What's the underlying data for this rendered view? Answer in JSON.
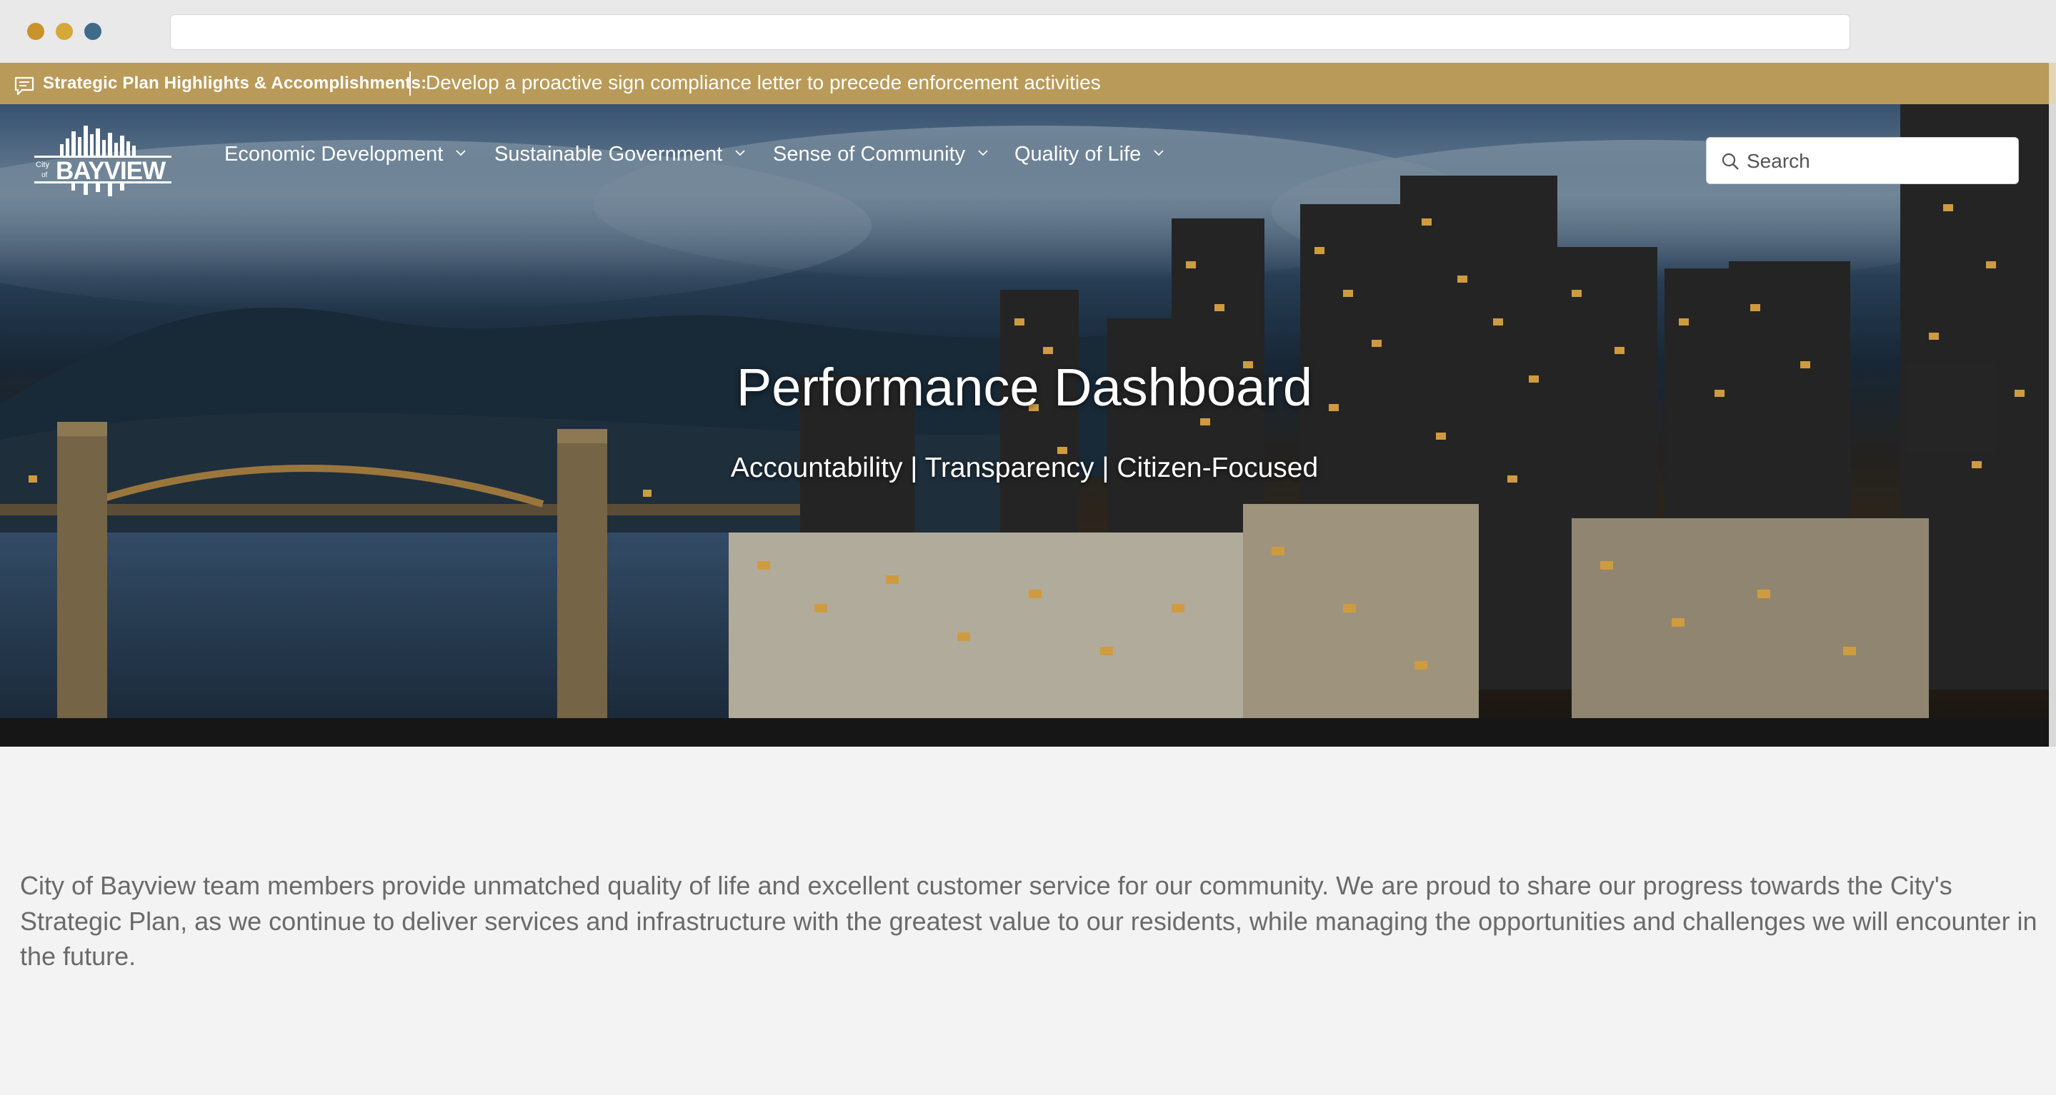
{
  "browser": {
    "dot_colors": [
      "#c9922a",
      "#d4a93a",
      "#3f6b8a"
    ]
  },
  "announcement": {
    "label": "Strategic Plan Highlights & Accomplishments:",
    "message": "Develop a proactive sign compliance letter to precede enforcement activities",
    "icon": "message-icon",
    "color": "#b99a58"
  },
  "header": {
    "logo": {
      "prefix_top": "City",
      "prefix_bottom": "of",
      "name": "BAYVIEW"
    },
    "nav": [
      {
        "label": "Economic Development"
      },
      {
        "label": "Sustainable Government"
      },
      {
        "label": "Sense of Community"
      },
      {
        "label": "Quality of Life"
      }
    ],
    "search": {
      "placeholder": "Search",
      "icon": "search-icon"
    }
  },
  "hero": {
    "title": "Performance Dashboard",
    "subtitle": "Accountability | Transparency | Citizen-Focused"
  },
  "intro": {
    "text": "City of Bayview team members provide unmatched quality of life and excellent customer service for our community. We are proud to share our progress towards the City's Strategic Plan, as we continue to deliver services and infrastructure with the greatest value to our residents, while managing the opportunities and challenges we will encounter in the future."
  }
}
